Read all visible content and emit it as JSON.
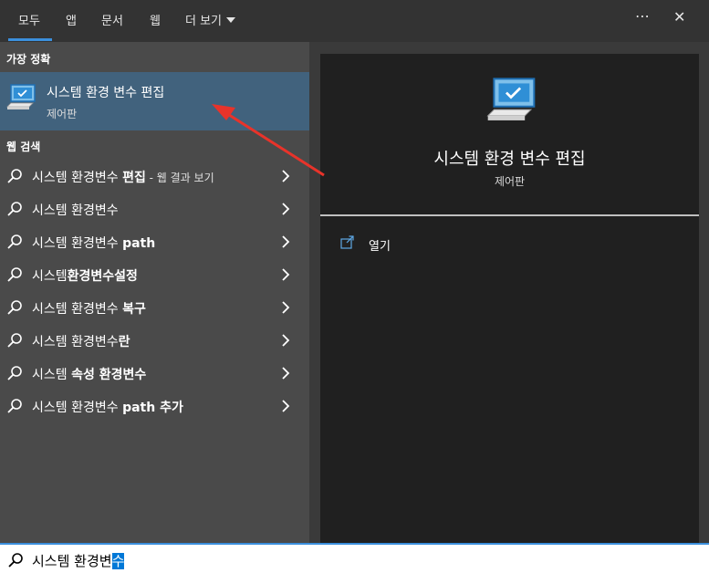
{
  "tabs": [
    {
      "label": "모두",
      "active": true
    },
    {
      "label": "앱"
    },
    {
      "label": "문서"
    },
    {
      "label": "웹"
    },
    {
      "label": "더 보기"
    }
  ],
  "top_icons": {
    "more": "⋯",
    "close": "✕"
  },
  "best_match": {
    "section_title": "가장 정확",
    "title": "시스템 환경 변수 편집",
    "subtitle": "제어판",
    "icon": "system-pc-icon"
  },
  "web_search": {
    "section_title": "웹 검색",
    "items": [
      {
        "prefix": "시스템 환경변수 ",
        "bold": "편집",
        "suffix": " - 웹 결과 보기"
      },
      {
        "prefix": "시스템 환경변수",
        "bold": "",
        "suffix": ""
      },
      {
        "prefix": "시스템 환경변수 ",
        "bold": "path",
        "suffix": ""
      },
      {
        "prefix": "시스템",
        "bold": "환경변수설정",
        "suffix": ""
      },
      {
        "prefix": "시스템 환경변수 ",
        "bold": "복구",
        "suffix": ""
      },
      {
        "prefix": "시스템 환경변수",
        "bold": "란",
        "suffix": ""
      },
      {
        "prefix": "시스템 ",
        "bold": "속성 환경변수",
        "suffix": ""
      },
      {
        "prefix": "시스템 환경변수 ",
        "bold": "path 추가",
        "suffix": ""
      }
    ]
  },
  "detail": {
    "title": "시스템 환경 변수 편집",
    "subtitle": "제어판",
    "actions": [
      {
        "label": "열기",
        "icon": "open-icon"
      }
    ]
  },
  "search": {
    "text_before": "시스템 환경변",
    "text_selected": "수"
  },
  "colors": {
    "accent": "#3b8fdc",
    "selected_row": "#41627d",
    "left_panel": "#4a4a4a",
    "detail_panel": "#202020",
    "annotation_arrow": "#e8332a"
  }
}
